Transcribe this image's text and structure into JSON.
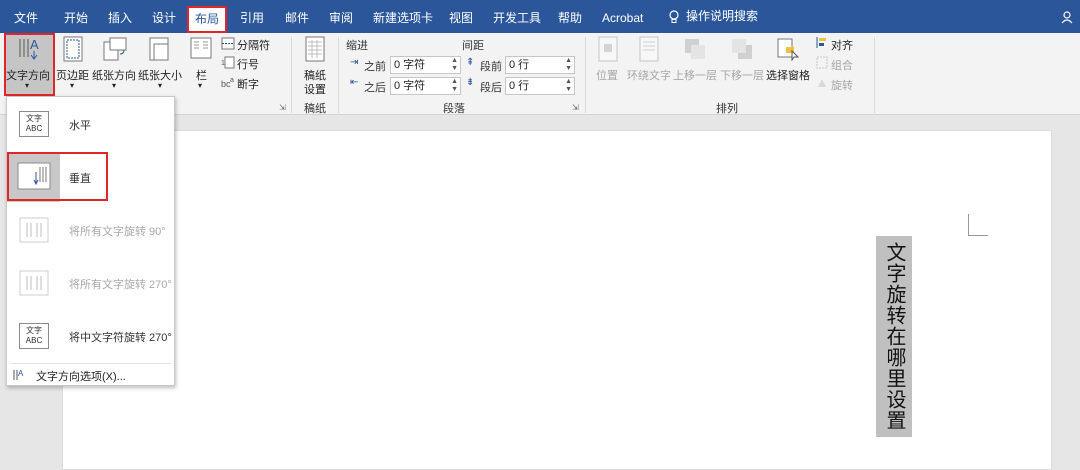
{
  "tabs": {
    "file": "文件",
    "home": "开始",
    "insert": "插入",
    "design": "设计",
    "layout": "布局",
    "references": "引用",
    "mailings": "邮件",
    "review": "审阅",
    "new_tab": "新建选项卡",
    "view": "视图",
    "developer": "开发工具",
    "help": "帮助",
    "acrobat": "Acrobat",
    "search": "操作说明搜索"
  },
  "ribbon": {
    "text_direction": "文字方向",
    "margins": "页边距",
    "orientation": "纸张方向",
    "size": "纸张大小",
    "columns": "栏",
    "breaks": "分隔符",
    "line_numbers": "行号",
    "hyphenation": "断字",
    "manuscript_line1": "稿纸",
    "manuscript_line2": "设置",
    "manuscript_group": "稿纸",
    "indent_header": "缩进",
    "spacing_header": "间距",
    "indent_before_label": "之前",
    "indent_before_value": "0 字符",
    "indent_after_label": "之后",
    "indent_after_value": "0 字符",
    "space_before_label": "段前",
    "space_before_value": "0 行",
    "space_after_label": "段后",
    "space_after_value": "0 行",
    "paragraph_group": "段落",
    "position": "位置",
    "wrap_text": "环绕文字",
    "bring_forward": "上移一层",
    "send_backward": "下移一层",
    "selection_pane": "选择窗格",
    "align": "对齐",
    "group": "组合",
    "rotate": "旋转",
    "arrange_group": "排列"
  },
  "menu": {
    "items": [
      {
        "label": "水平",
        "icon_text": "文字 ABC"
      },
      {
        "label": "垂直"
      },
      {
        "label": "将所有文字旋转 90°"
      },
      {
        "label": "将所有文字旋转 270°"
      },
      {
        "label": "将中文字符旋转 270°",
        "icon_text": "文字 ABC"
      }
    ],
    "options": "文字方向选项(X)..."
  },
  "document": {
    "vertical_text": "文字旋转在哪里设置"
  },
  "colors": {
    "tabbar": "#2b579a",
    "highlight": "#e0262a",
    "textbox": "#c0c0c0"
  }
}
